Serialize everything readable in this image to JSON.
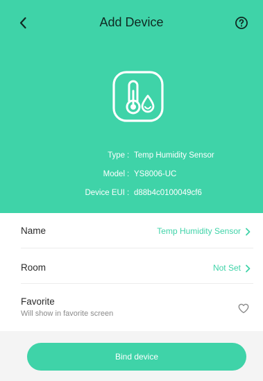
{
  "header": {
    "title": "Add Device",
    "back_icon": "chevron-left-icon",
    "help_icon": "question-circle-icon",
    "background_color": "#3fd3a8"
  },
  "device": {
    "icon": "temp-humidity-icon",
    "type_label": "Type",
    "type_value": "Temp Humidity Sensor",
    "model_label": "Model",
    "model_value": "YS8006-UC",
    "eui_label": "Device EUI",
    "eui_value": "d88b4c0100049cf6",
    "separator": ":"
  },
  "form": {
    "name": {
      "label": "Name",
      "value": "Temp Humidity Sensor"
    },
    "room": {
      "label": "Room",
      "value": "Not Set"
    },
    "favorite": {
      "label": "Favorite",
      "sublabel": "Will show in favorite screen",
      "icon": "heart-outline-icon",
      "checked": false
    }
  },
  "actions": {
    "bind_label": "Bind device"
  },
  "colors": {
    "accent": "#3fd3a8",
    "text": "#2a2a2a",
    "subtext": "#8a8a8a"
  }
}
